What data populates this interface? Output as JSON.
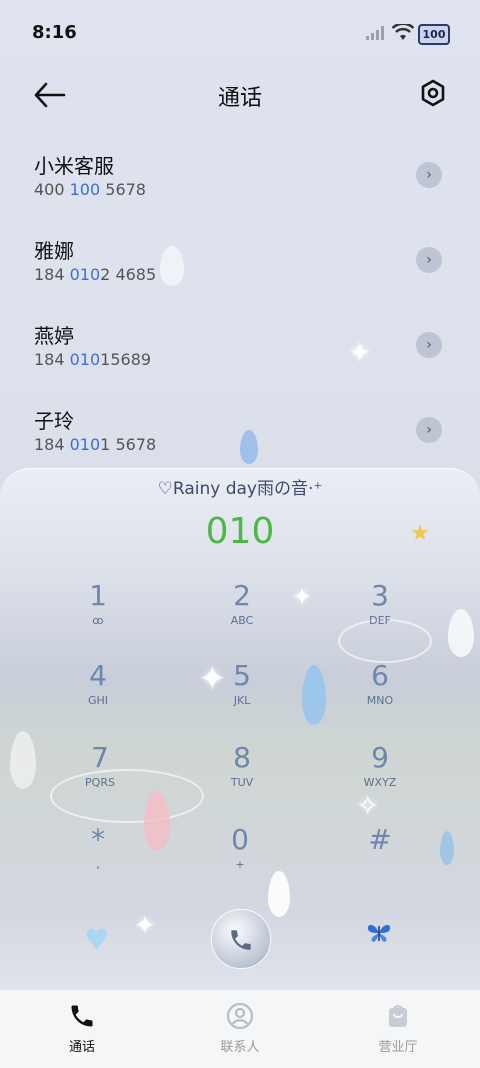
{
  "status": {
    "time": "8:16",
    "battery": "100"
  },
  "header": {
    "title": "通话"
  },
  "calls": [
    {
      "name": "小米客服",
      "num_a": "400 ",
      "num_hl": "100",
      "num_b": " 5678"
    },
    {
      "name": "雅娜",
      "num_a": "184 ",
      "num_hl": "010",
      "num_b": "2 4685"
    },
    {
      "name": "燕婷",
      "num_a": "184 ",
      "num_hl": "010",
      "num_b": "15689"
    },
    {
      "name": "子玲",
      "num_a": "184 ",
      "num_hl": "010",
      "num_b": "1 5678"
    }
  ],
  "dialpad": {
    "theme_label": "♡Rainy day雨の音·⁺",
    "entry": "010",
    "keys": [
      {
        "digit": "1",
        "letters": "ꝏ"
      },
      {
        "digit": "2",
        "letters": "ABC"
      },
      {
        "digit": "3",
        "letters": "DEF"
      },
      {
        "digit": "4",
        "letters": "GHI"
      },
      {
        "digit": "5",
        "letters": "JKL"
      },
      {
        "digit": "6",
        "letters": "MNO"
      },
      {
        "digit": "7",
        "letters": "PQRS"
      },
      {
        "digit": "8",
        "letters": "TUV"
      },
      {
        "digit": "9",
        "letters": "WXYZ"
      },
      {
        "digit": "*",
        "letters": ","
      },
      {
        "digit": "0",
        "letters": "+"
      },
      {
        "digit": "#",
        "letters": ""
      }
    ]
  },
  "nav": {
    "tabs": [
      {
        "label": "通话",
        "icon": "phone-icon",
        "active": true
      },
      {
        "label": "联系人",
        "icon": "contact-icon",
        "active": false
      },
      {
        "label": "营业厅",
        "icon": "shop-bag-icon",
        "active": false
      }
    ]
  },
  "colors": {
    "accent": "#3c6fd4",
    "entry": "#4cb848",
    "key_digit": "#6f86ae"
  }
}
